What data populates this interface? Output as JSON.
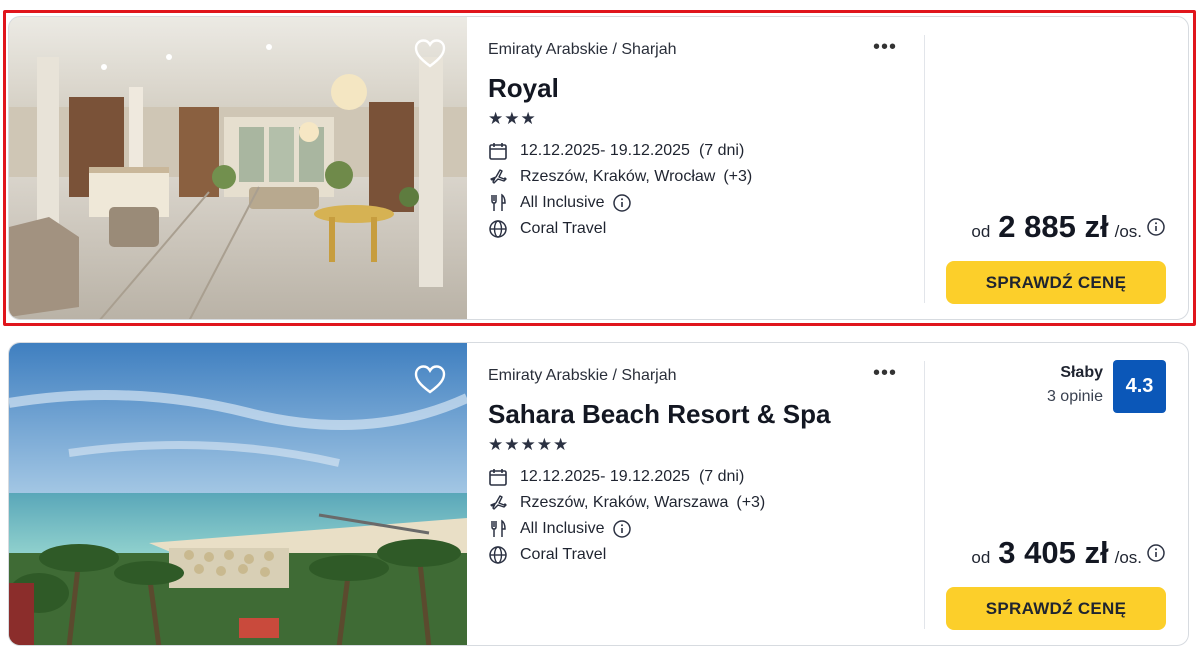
{
  "offers": [
    {
      "destination": "Emiraty Arabskie / Sharjah",
      "name": "Royal",
      "stars": "★★★",
      "dates": "12.12.2025- 19.12.2025",
      "duration": "(7 dni)",
      "departures": "Rzeszów, Kraków, Wrocław",
      "departures_more": "(+3)",
      "board": "All Inclusive",
      "operator": "Coral Travel",
      "price_prefix": "od",
      "price": "2 885 zł",
      "price_suffix": "/os.",
      "cta": "SPRAWDŹ CENĘ",
      "more_menu": "•••"
    },
    {
      "destination": "Emiraty Arabskie / Sharjah",
      "name": "Sahara Beach Resort & Spa",
      "stars": "★★★★★",
      "dates": "12.12.2025- 19.12.2025",
      "duration": "(7 dni)",
      "departures": "Rzeszów, Kraków, Warszawa",
      "departures_more": "(+3)",
      "board": "All Inclusive",
      "operator": "Coral Travel",
      "rating_label": "Słaby",
      "rating_count": "3 opinie",
      "rating_score": "4.3",
      "price_prefix": "od",
      "price": "3 405 zł",
      "price_suffix": "/os.",
      "cta": "SPRAWDŹ CENĘ",
      "more_menu": "•••"
    }
  ],
  "colors": {
    "cta": "#fccf2a",
    "rating_badge": "#0b57b8",
    "highlight": "#e0151c"
  },
  "icons": [
    "heart-icon",
    "calendar-icon",
    "plane-icon",
    "cutlery-icon",
    "info-icon",
    "globe-icon",
    "more-icon"
  ]
}
